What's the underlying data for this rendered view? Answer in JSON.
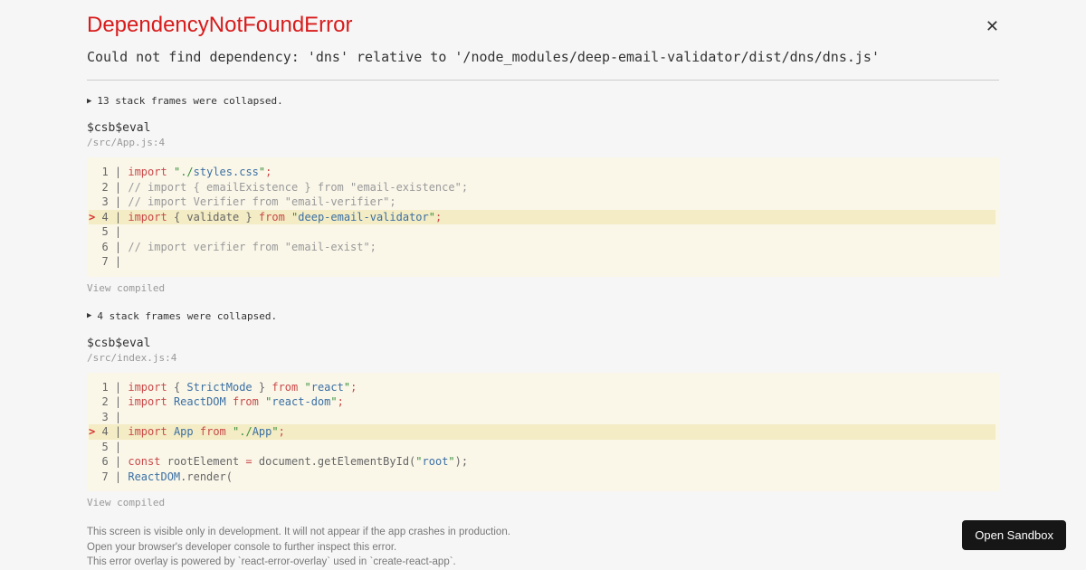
{
  "header": {
    "title": "DependencyNotFoundError",
    "message": "Could not find dependency: 'dns' relative to '/node_modules/deep-email-validator/dist/dns/dns.js'"
  },
  "collapsed1": "13 stack frames were collapsed.",
  "frame1": {
    "name": "$csb$eval",
    "path": "/src/App.js:4"
  },
  "code1": {
    "l1_gut": "  1 | ",
    "l1_kw": "import",
    "l1_sp": " ",
    "l1_q": "\"",
    "l1_dot": ".",
    "l1_sl": "/",
    "l1_mod": "styles.css",
    "l1_sc": ";",
    "l2_gut": "  2 | ",
    "l2_com": "// import { emailExistence } from \"email-existence\";",
    "l3_gut": "  3 | ",
    "l3_com": "// import Verifier from \"email-verifier\";",
    "l4_car": ">",
    "l4_gut": " 4 | ",
    "l4_kw": "import",
    "l4_b1": " { ",
    "l4_val": "validate",
    "l4_b2": " } ",
    "l4_from": "from",
    "l4_sp": " ",
    "l4_q": "\"",
    "l4_mod": "deep-email-validator",
    "l4_sc": ";",
    "l5_gut": "  5 | ",
    "l6_gut": "  6 | ",
    "l6_com": "// import verifier from \"email-exist\";",
    "l7_gut": "  7 | "
  },
  "view_compiled": "View compiled",
  "collapsed2": "4 stack frames were collapsed.",
  "frame2": {
    "name": "$csb$eval",
    "path": "/src/index.js:4"
  },
  "code2": {
    "l1_gut": "  1 | ",
    "l1_kw": "import",
    "l1_b1": " { ",
    "l1_sm": "StrictMode",
    "l1_b2": " } ",
    "l1_from": "from",
    "l1_sp": " ",
    "l1_q": "\"",
    "l1_mod": "react",
    "l1_sc": ";",
    "l2_gut": "  2 | ",
    "l2_kw": "import",
    "l2_sp": " ",
    "l2_rd": "ReactDOM",
    "l2_from": " from",
    "l2_sp2": " ",
    "l2_q": "\"",
    "l2_mod": "react-dom",
    "l2_sc": ";",
    "l3_gut": "  3 | ",
    "l4_car": ">",
    "l4_gut": " 4 | ",
    "l4_kw": "import",
    "l4_sp": " ",
    "l4_app": "App",
    "l4_from": " from",
    "l4_sp2": " ",
    "l4_q": "\"",
    "l4_dot": ".",
    "l4_sl": "/",
    "l4_mod": "App",
    "l4_sc": ";",
    "l5_gut": "  5 | ",
    "l6_gut": "  6 | ",
    "l6_const": "const",
    "l6_sp": " ",
    "l6_re": "rootElement ",
    "l6_eq": "=",
    "l6_call": " document.getElementById(",
    "l6_q": "\"",
    "l6_root": "root",
    "l6_end": ");",
    "l7_gut": "  7 | ",
    "l7_rd": "ReactDOM",
    "l7_rest": ".render("
  },
  "foot": {
    "l1": "This screen is visible only in development. It will not appear if the app crashes in production.",
    "l2": "Open your browser's developer console to further inspect this error.",
    "l3": "This error overlay is powered by `react-error-overlay` used in `create-react-app`."
  },
  "sandbox_button": "Open Sandbox"
}
